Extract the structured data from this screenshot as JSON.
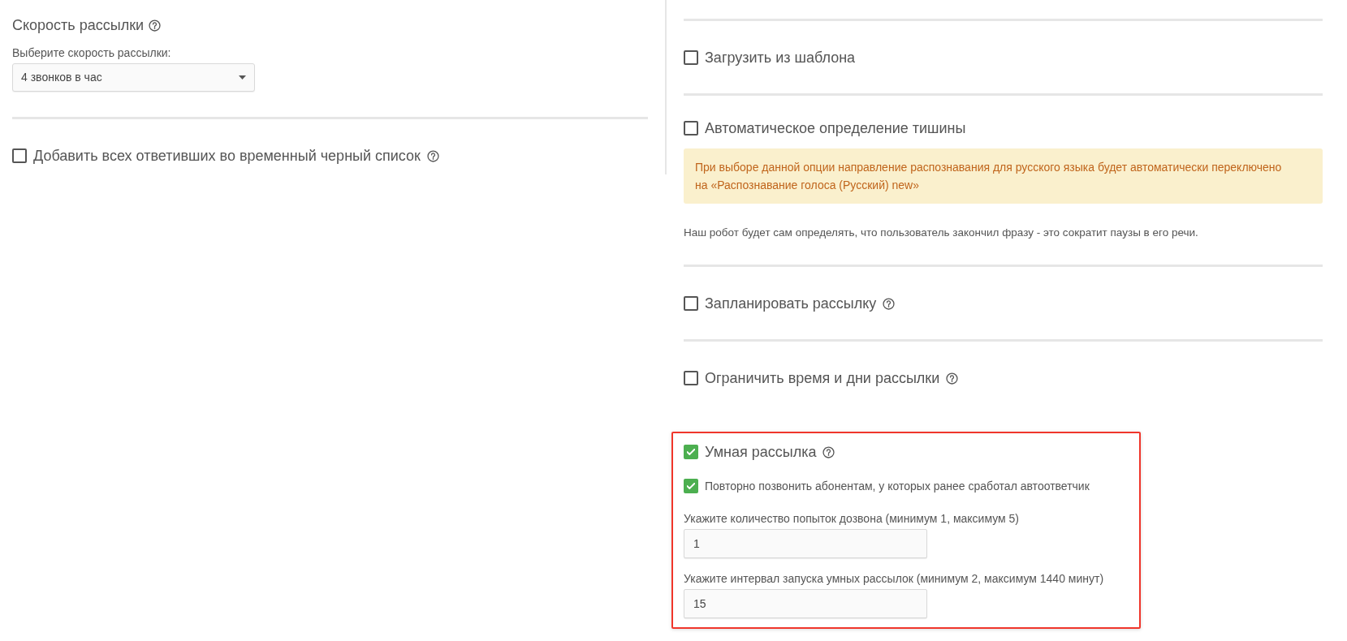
{
  "left": {
    "speed": {
      "title": "Скорость рассылки",
      "help": true,
      "select_label": "Выберите скорость рассылки:",
      "select_value": "4 звонков в час"
    },
    "options": [
      {
        "label": "Добавить всех ответивших во временный черный список",
        "checked": false,
        "help": true
      }
    ]
  },
  "right": {
    "sections": [
      {
        "label": "Загрузить из шаблона",
        "checked": false,
        "help": false,
        "highlighted": false
      },
      {
        "label": "Автоматическое определение тишины",
        "checked": false,
        "help": false,
        "highlighted": false,
        "alert": "При выборе данной опции направление распознавания для русского языка будет автоматически переключено на «Распознавание голоса (Русский) new»",
        "note": "Наш робот будет сам определять, что пользователь закончил фразу - это сократит паузы в его речи."
      },
      {
        "label": "Запланировать рассылку",
        "checked": false,
        "help": true,
        "highlighted": false
      },
      {
        "label": "Ограничить время и дни рассылки",
        "checked": false,
        "help": true,
        "highlighted": false
      },
      {
        "label": "Умная рассылка",
        "checked": true,
        "help": true,
        "highlighted": true,
        "suboptions": [
          {
            "label": "Повторно позвонить абонентам, у которых ранее сработал автоответчик",
            "checked": true
          }
        ],
        "fields": [
          {
            "label": "Укажите количество попыток дозвона (минимум 1, максимум 5)",
            "value": "1"
          },
          {
            "label": "Укажите интервал запуска умных рассылок (минимум 2, максимум 1440 минут)",
            "value": "15"
          }
        ]
      }
    ]
  }
}
